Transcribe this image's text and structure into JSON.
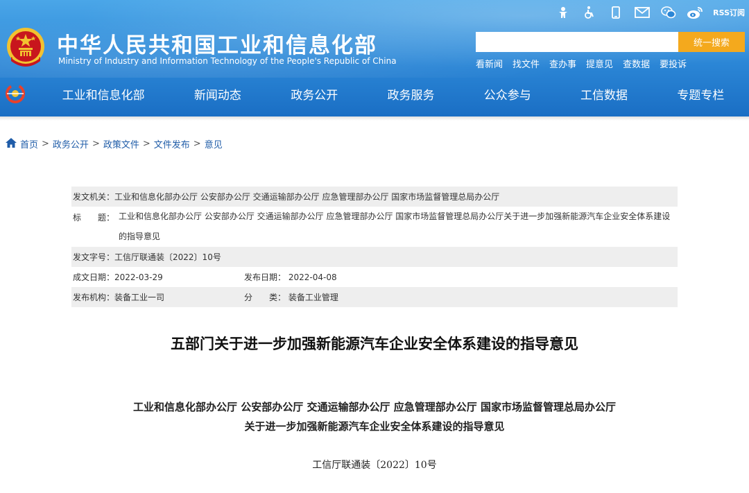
{
  "header": {
    "site_title": "中华人民共和国工业和信息化部",
    "site_subtitle": "Ministry of Industry and Information Technology of the People's Republic of China",
    "top_icons": [
      "accessibility-icon",
      "wheelchair-icon",
      "mobile-icon",
      "mail-icon",
      "wechat-icon",
      "weibo-icon"
    ],
    "rss_label": "RSS订阅",
    "search": {
      "placeholder": "",
      "button_label": "统一搜索"
    },
    "quick_links": [
      "看新闻",
      "找文件",
      "查办事",
      "提意见",
      "查数据",
      "要投诉"
    ],
    "colors": {
      "header_blue": "#2b86d6",
      "search_button": "#f4a91d",
      "emblem_red": "#c8161d",
      "emblem_gold": "#f2c230"
    }
  },
  "nav": {
    "items": [
      "工业和信息化部",
      "新闻动态",
      "政务公开",
      "政务服务",
      "公众参与",
      "工信数据",
      "专题专栏"
    ]
  },
  "breadcrumb": {
    "items": [
      "首页",
      "政务公开",
      "政策文件",
      "文件发布",
      "意见"
    ],
    "separator": ">"
  },
  "meta": {
    "issuer_label": "发文机关：",
    "issuer_value": "工业和信息化部办公厅 公安部办公厅 交通运输部办公厅 应急管理部办公厅 国家市场监督管理总局办公厅",
    "title_label": "标　　题：",
    "title_value": "工业和信息化部办公厅 公安部办公厅 交通运输部办公厅 应急管理部办公厅 国家市场监督管理总局办公厅关于进一步加强新能源汽车企业安全体系建设的指导意见",
    "doc_no_label": "发文字号：",
    "doc_no_value": "工信厅联通装〔2022〕10号",
    "created_label": "成文日期：",
    "created_value": "2022-03-29",
    "published_label": "发布日期：",
    "published_value": "2022-04-08",
    "agency_label": "发布机构：",
    "agency_value": "装备工业一司",
    "category_label": "分　　类：",
    "category_value": "装备工业管理"
  },
  "document": {
    "title": "五部门关于进一步加强新能源汽车企业安全体系建设的指导意见",
    "issuers": "工业和信息化部办公厅  公安部办公厅  交通运输部办公厅  应急管理部办公厅  国家市场监督管理总局办公厅",
    "subtitle": "关于进一步加强新能源汽车企业安全体系建设的指导意见",
    "doc_number": "工信厅联通装〔2022〕10号"
  }
}
